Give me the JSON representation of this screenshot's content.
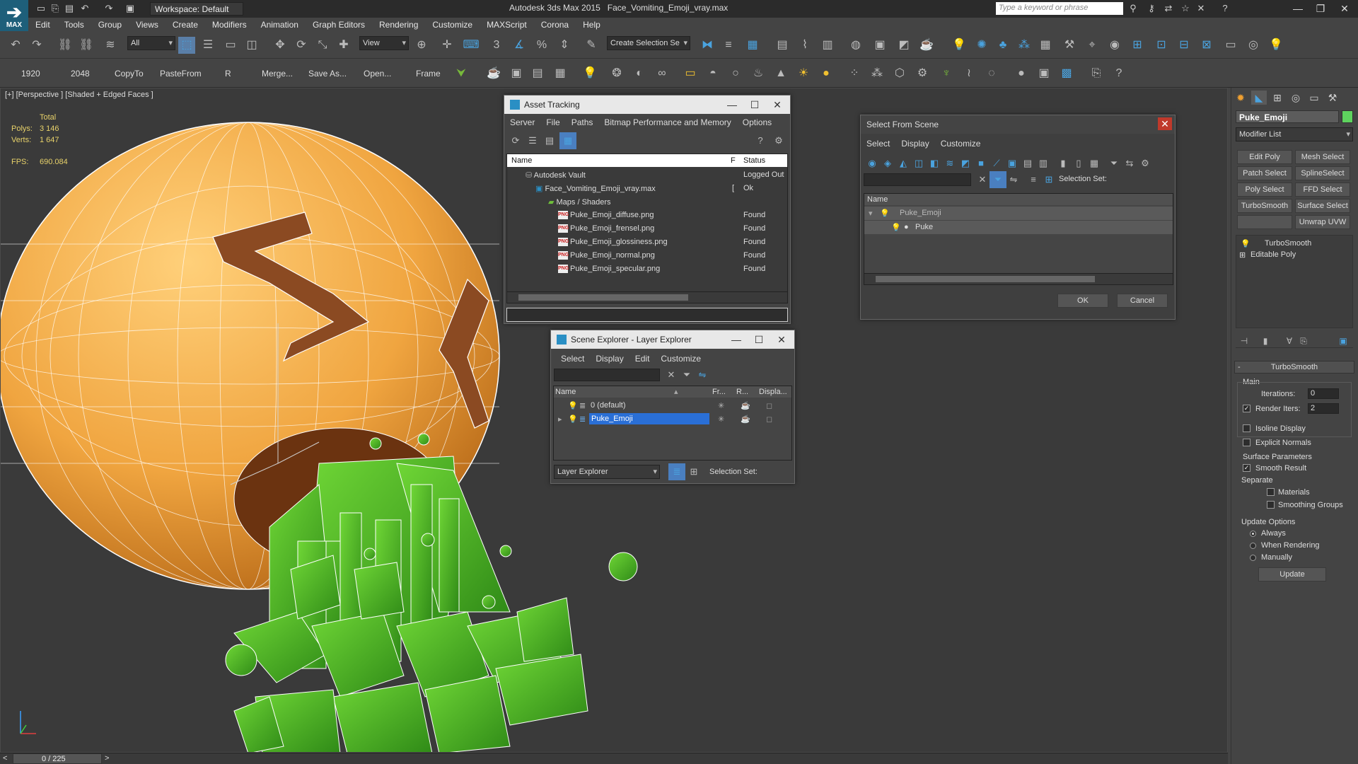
{
  "app": {
    "workspace": "Workspace: Default",
    "title_app": "Autodesk 3ds Max  2015",
    "title_file": "Face_Vomiting_Emoji_vray.max",
    "search_placeholder": "Type a keyword or phrase",
    "logo_text": "MAX"
  },
  "menu": [
    "Edit",
    "Tools",
    "Group",
    "Views",
    "Create",
    "Modifiers",
    "Animation",
    "Graph Editors",
    "Rendering",
    "Customize",
    "MAXScript",
    "Corona",
    "Help"
  ],
  "toolbar1": {
    "selection_filter": "All",
    "ref_coord": "View",
    "named_selection_placeholder": "Create Selection Se"
  },
  "toolbar2": {
    "labels": [
      "1920",
      "2048",
      "CopyTo",
      "PasteFrom",
      "R",
      "Merge...",
      "Save As...",
      "Open...",
      "Frame"
    ]
  },
  "viewport": {
    "label": "[+] [Perspective ] [Shaded + Edged Faces ]",
    "stats_total": "Total",
    "polys_label": "Polys:",
    "polys_value": "3 146",
    "verts_label": "Verts:",
    "verts_value": "1 647",
    "fps_label": "FPS:",
    "fps_value": "690.084"
  },
  "timeline": {
    "frame": "0 / 225"
  },
  "asset_tracking": {
    "title": "Asset Tracking",
    "menu": [
      "Server",
      "File",
      "Paths",
      "Bitmap Performance and Memory",
      "Options"
    ],
    "col_name": "Name",
    "col_f": "F",
    "col_status": "Status",
    "rows": [
      {
        "name": "Autodesk Vault",
        "f": "",
        "status": "Logged Out"
      },
      {
        "name": "Face_Vomiting_Emoji_vray.max",
        "f": "[",
        "status": "Ok"
      },
      {
        "name": "Maps / Shaders",
        "f": "",
        "status": ""
      },
      {
        "name": "Puke_Emoji_diffuse.png",
        "f": "",
        "status": "Found"
      },
      {
        "name": "Puke_Emoji_frensel.png",
        "f": "",
        "status": "Found"
      },
      {
        "name": "Puke_Emoji_glossiness.png",
        "f": "",
        "status": "Found"
      },
      {
        "name": "Puke_Emoji_normal.png",
        "f": "",
        "status": "Found"
      },
      {
        "name": "Puke_Emoji_specular.png",
        "f": "",
        "status": "Found"
      }
    ],
    "png_badge": "PNG"
  },
  "select_from_scene": {
    "title": "Select From Scene",
    "menu": [
      "Select",
      "Display",
      "Customize"
    ],
    "selection_set_label": "Selection Set:",
    "col_name": "Name",
    "items": [
      "Puke_Emoji",
      "Puke"
    ],
    "ok": "OK",
    "cancel": "Cancel"
  },
  "scene_explorer": {
    "title": "Scene Explorer - Layer Explorer",
    "menu": [
      "Select",
      "Display",
      "Edit",
      "Customize"
    ],
    "cols": [
      "Name",
      "Fr...",
      "R...",
      "Displa..."
    ],
    "rows": [
      "0 (default)",
      "Puke_Emoji"
    ],
    "footer_dropdown": "Layer Explorer",
    "selection_set_label": "Selection Set:"
  },
  "command_panel": {
    "object_name": "Puke_Emoji",
    "object_color": "#5ed35e",
    "modifier_list": "Modifier List",
    "buttons": [
      "Edit Poly",
      "Mesh Select",
      "Patch Select",
      "SplineSelect",
      "Poly Select",
      "FFD Select",
      "TurboSmooth",
      "Surface Select",
      "Unwrap UVW"
    ],
    "stack": [
      "TurboSmooth",
      "Editable Poly"
    ],
    "rollout_title": "TurboSmooth",
    "main_label": "Main",
    "iterations_label": "Iterations:",
    "iterations_value": "0",
    "render_iters_label": "Render Iters:",
    "render_iters_value": "2",
    "isoline_label": "Isoline Display",
    "explicit_label": "Explicit Normals",
    "surface_params_label": "Surface Parameters",
    "smooth_result_label": "Smooth Result",
    "separate_label": "Separate",
    "materials_label": "Materials",
    "smoothing_groups_label": "Smoothing Groups",
    "update_options_label": "Update Options",
    "always_label": "Always",
    "when_rendering_label": "When Rendering",
    "manually_label": "Manually",
    "update_button": "Update"
  },
  "colors": {
    "emoji": "#f0a540",
    "puke": "#4fb82a",
    "wire": "#ffffff",
    "selection_blue": "#2a6fd6"
  }
}
